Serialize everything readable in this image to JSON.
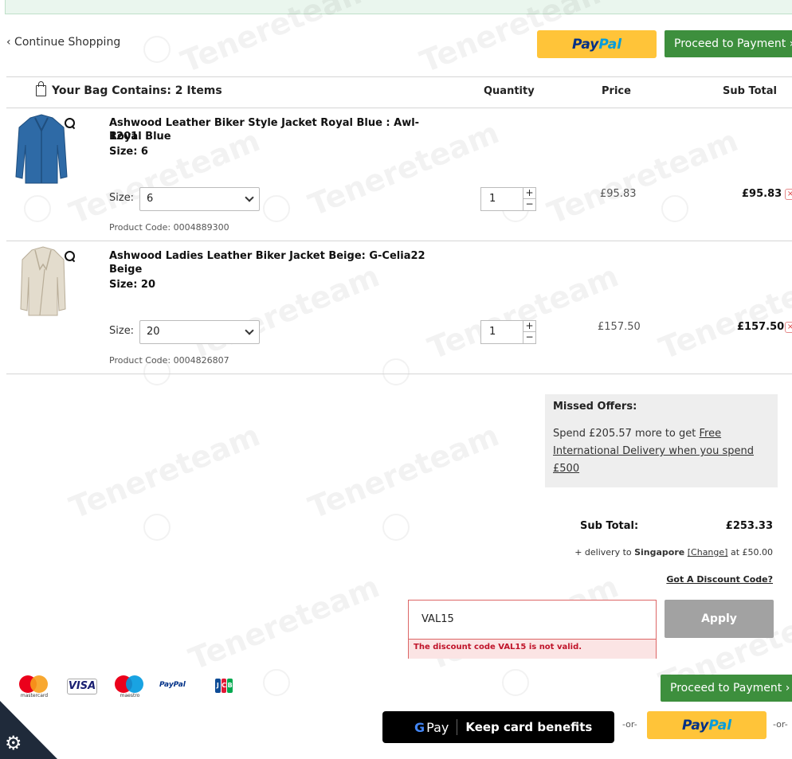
{
  "header": {
    "continue_label": "‹ Continue Shopping",
    "paypal_pay": "Pay",
    "paypal_pal": "Pal",
    "proceed_label": "Proceed to Payment ›"
  },
  "bag": {
    "title": "Your Bag Contains: 2 Items",
    "col_quantity": "Quantity",
    "col_price": "Price",
    "col_subtotal": "Sub Total"
  },
  "items": [
    {
      "name": "Ashwood Leather Biker Style Jacket Royal Blue : Awl-1201",
      "color": "Royal Blue",
      "size_line": "Size: 6",
      "size_label": "Size:",
      "size_value": "6",
      "product_code": "Product Code: 0004889300",
      "quantity": "1",
      "price": "£95.83",
      "subtotal": "£95.83",
      "image_color": "#2e6aa6"
    },
    {
      "name": "Ashwood Ladies Leather Biker Jacket Beige: G-Celia22",
      "color": "Beige",
      "size_line": "Size: 20",
      "size_label": "Size:",
      "size_value": "20",
      "product_code": "Product Code: 0004826807",
      "quantity": "1",
      "price": "£157.50",
      "subtotal": "£157.50",
      "image_color": "#e3dccd"
    }
  ],
  "offers": {
    "title": "Missed Offers:",
    "text_prefix": "Spend £205.57 more to get ",
    "link": "Free International Delivery when you spend £500"
  },
  "totals": {
    "sub_total_label": "Sub Total:",
    "sub_total_value": "£253.33",
    "delivery_prefix": "+ delivery to ",
    "delivery_country": "Singapore",
    "delivery_change": "[Change]",
    "delivery_suffix": " at £50.00",
    "discount_link": "Got A Discount Code?"
  },
  "discount": {
    "code": "VAL15",
    "error": "The discount code VAL15 is not valid.",
    "apply_label": "Apply"
  },
  "payment_logos": {
    "mastercard": "mastercard",
    "visa": "VISA",
    "maestro": "maestro",
    "paypal": "PayPal",
    "jcb": [
      "J",
      "C",
      "B"
    ]
  },
  "footer": {
    "proceed_label": "Proceed to Payment ›",
    "gpay_g": "G",
    "gpay_pay": "Pay",
    "gpay_text": "Keep card benefits",
    "or_label": "-or-",
    "paypal_pay": "Pay",
    "paypal_pal": "Pal"
  },
  "watermark": "Tenereteam",
  "colors": {
    "green": "#3d8f3d",
    "paypal_yellow": "#ffc439",
    "error_red": "#c0142a"
  }
}
